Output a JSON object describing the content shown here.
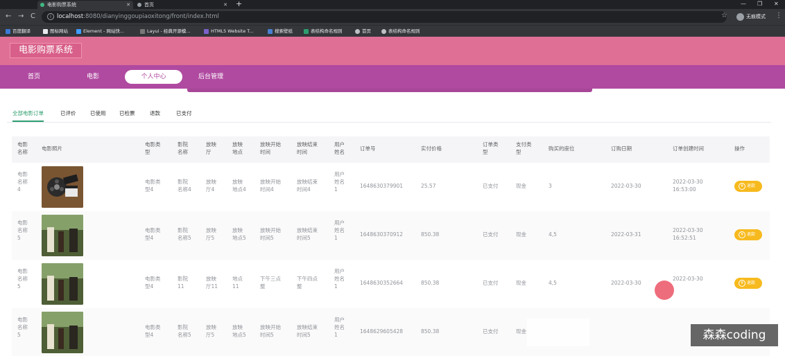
{
  "browser": {
    "tabs": [
      {
        "title": "电影购票系统",
        "active": true
      },
      {
        "title": "首页",
        "active": false
      }
    ],
    "url_host": "localhost",
    "url_rest": ":8080/dianyinggoupiaoxitong/front/index.html",
    "profile_label": "无痕模式",
    "bookmarks": [
      "百度翻译",
      "图标网站",
      "Element - 网站快...",
      "Layui - 经典开源模...",
      "HTML5 Website T...",
      "搜索壁纸",
      "表结构命名规则",
      "首页",
      "表结构命名规则"
    ]
  },
  "site": {
    "logo": "电影购票系统",
    "nav": [
      "首页",
      "电影",
      "个人中心",
      "后台管理"
    ]
  },
  "order_tabs": [
    "全部电影订单",
    "已评价",
    "已使用",
    "已检票",
    "退款",
    "已支付"
  ],
  "table": {
    "headers": {
      "film_name": "电影\n名称",
      "film_photo": "电影照片",
      "film_type": "电影类\n型",
      "cinema": "影院\n名称",
      "hall": "放映\n厅",
      "place": "放映\n地点",
      "start": "放映开始\n时间",
      "end": "放映结束\n时间",
      "user": "用户\n姓名",
      "order_no": "订单号",
      "price": "实付价格",
      "order_type": "订单类\n型",
      "pay_type": "支付类\n型",
      "seat": "购买的座位",
      "order_date": "订购日期",
      "created": "订单创建时间",
      "ops": "操作"
    },
    "rows": [
      {
        "film_name": "电影\n名称\n4",
        "film_type": "电影类\n型4",
        "cinema": "影院\n名称4",
        "hall": "放映\n厅4",
        "place": "放映\n地点4",
        "start": "放映开始\n时间4",
        "end": "放映结束\n时间4",
        "user": "用户\n姓名\n1",
        "order_no": "1648630379901",
        "price": "25.57",
        "order_type": "已支付",
        "pay_type": "现金",
        "seat": "3",
        "order_date": "2022-03-30",
        "created": "2022-03-30\n16:53:00",
        "action": "退款"
      },
      {
        "film_name": "电影\n名称\n5",
        "film_type": "电影类\n型4",
        "cinema": "影院\n名称5",
        "hall": "放映\n厅5",
        "place": "放映\n地点5",
        "start": "放映开始\n时间5",
        "end": "放映结束\n时间5",
        "user": "用户\n姓名\n1",
        "order_no": "1648630370912",
        "price": "850.38",
        "order_type": "已支付",
        "pay_type": "现金",
        "seat": "4,5",
        "order_date": "2022-03-31",
        "created": "2022-03-30\n16:52:51",
        "action": "退款"
      },
      {
        "film_name": "电影\n名称\n5",
        "film_type": "电影类\n型4",
        "cinema": "影院\n11",
        "hall": "放映\n厅11",
        "place": "地点\n11",
        "start": "下午三点\n整",
        "end": "下午四点\n整",
        "user": "用户\n姓名\n1",
        "order_no": "1648630352664",
        "price": "850.38",
        "order_type": "已支付",
        "pay_type": "现金",
        "seat": "4,5",
        "order_date": "2022-03-30",
        "created": "2022-03-30",
        "action": "退款"
      },
      {
        "film_name": "电影\n名称\n5",
        "film_type": "电影类\n型4",
        "cinema": "影院\n名称5",
        "hall": "放映\n厅5",
        "place": "放映\n地点5",
        "start": "放映开始\n时间5",
        "end": "放映结束\n时间5",
        "user": "用户\n姓名\n1",
        "order_no": "1648629605428",
        "price": "850.38",
        "order_type": "已支付",
        "pay_type": "现金",
        "seat": "",
        "order_date": "",
        "created": "",
        "action": ""
      }
    ]
  },
  "watermark": "森森coding",
  "colors": {
    "header": "#e06f95",
    "navbar": "#b04aa0",
    "accent_green": "#2e9d6f",
    "refund_button": "#f7ba1e"
  }
}
